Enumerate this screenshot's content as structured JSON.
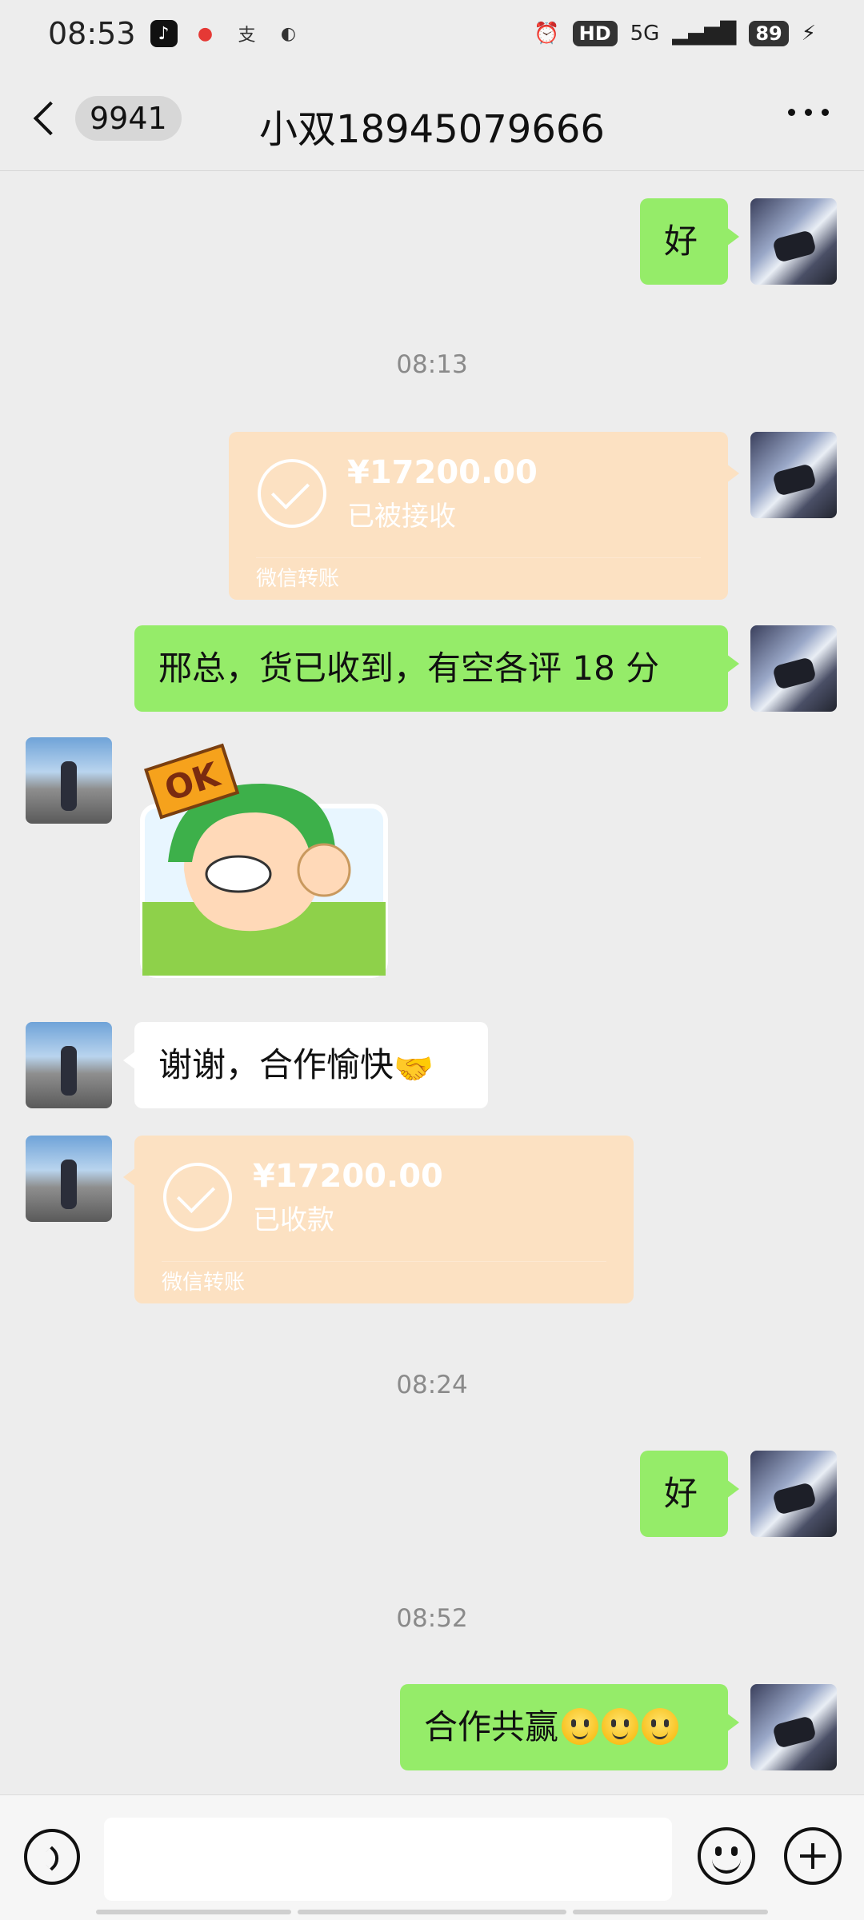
{
  "status_bar": {
    "time": "08:53",
    "app_icons": [
      "tiktok-icon",
      "map-pin-icon",
      "alipay-icon",
      "browser-icon"
    ],
    "hd": "HD",
    "network": "5G",
    "battery": "89"
  },
  "nav": {
    "unread_count": "9941",
    "title": "小双18945079666",
    "more_icon": "more-dots-icon"
  },
  "messages": {
    "m1": "好",
    "ts1": "08:13",
    "t1": {
      "amount": "¥17200.00",
      "status": "已被接收",
      "label": "微信转账"
    },
    "m2": "邢总，货已收到，有空各评 18 分",
    "sticker_text": "OK",
    "m3": "谢谢，合作愉快",
    "t2": {
      "amount": "¥17200.00",
      "status": "已收款",
      "label": "微信转账"
    },
    "ts2": "08:24",
    "m4": "好",
    "ts3": "08:52",
    "m5": "合作共赢"
  },
  "input": {
    "placeholder": ""
  },
  "colors": {
    "me_bubble": "#95ec69",
    "transfer": "#fce1c2",
    "background": "#ededed"
  }
}
